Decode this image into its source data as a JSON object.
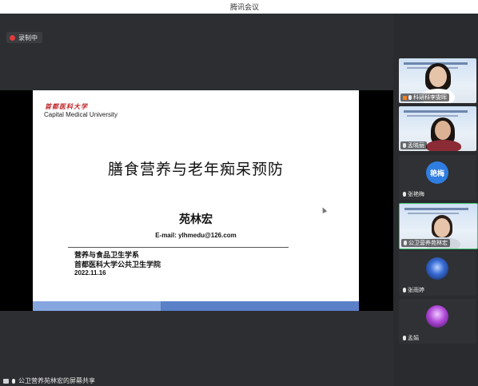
{
  "window": {
    "title": "腾讯会议"
  },
  "recording": {
    "label": "录制中",
    "indicator_color": "#e23b3b"
  },
  "slide": {
    "logo_cn": "首都医科大学",
    "logo_en": "Capital Medical University",
    "title": "膳食营养与老年痴呆预防",
    "author": "苑林宏",
    "email": "E-mail: ylhmedu@126.com",
    "affiliation_1": "营养与食品卫生学系",
    "affiliation_2": "首都医科大学公共卫生学院",
    "date": "2022.11.16",
    "accent_color": "#5a80c8"
  },
  "share_status": {
    "text": "公卫营养苑林宏的屏幕共享",
    "icon": "screen-share-icon"
  },
  "participants": [
    {
      "name": "科研科李雯晖",
      "type": "video",
      "is_host": true
    },
    {
      "name": "孟晓丽",
      "type": "video",
      "is_host": false
    },
    {
      "name": "张艳梅",
      "type": "avatar",
      "avatar_text": "艳梅",
      "avatar_color": "#2f7de1"
    },
    {
      "name": "公卫营养苑林宏",
      "type": "video",
      "is_host": false
    },
    {
      "name": "张雨婷",
      "type": "avatar-image",
      "avatar_color": "#1a3a8a"
    },
    {
      "name": "孟娟",
      "type": "avatar-image",
      "avatar_color": "#7a2a9a"
    }
  ]
}
